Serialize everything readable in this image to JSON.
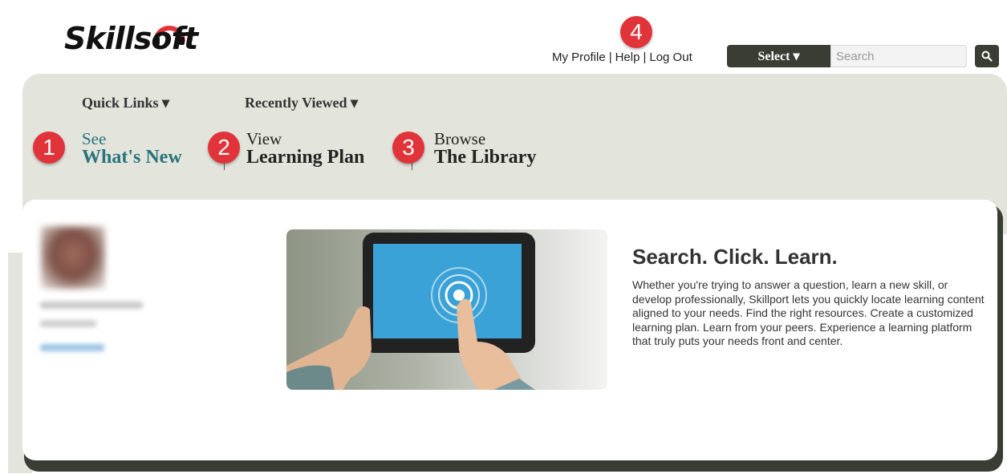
{
  "brand": {
    "logo_text": "Skillsoft",
    "colors": {
      "accent": "#e0343a",
      "dark": "#3a3d34",
      "band": "#e3e5dc",
      "teal": "#27737c"
    }
  },
  "topnav": {
    "my_profile": "My Profile",
    "help": "Help",
    "log_out": "Log Out",
    "select_label": "Select ▾",
    "search_placeholder": "Search",
    "search_icon": "search-icon"
  },
  "menu": {
    "quick_links": "Quick Links ▾",
    "recently_viewed": "Recently Viewed ▾"
  },
  "nav_links": [
    {
      "small": "See",
      "big": "What's New"
    },
    {
      "small": "View",
      "big": "Learning Plan"
    },
    {
      "small": "Browse",
      "big": "The Library"
    }
  ],
  "badges": [
    "1",
    "2",
    "3",
    "4"
  ],
  "main": {
    "headline": "Search. Click. Learn.",
    "blurb": "Whether you're trying to answer a question, learn a new skill, or develop professionally, Skillport lets you quickly locate learning content aligned to your needs. Find the right resources. Create a customized learning plan. Learn from your peers. Experience a learning platform that truly puts your needs front and center."
  }
}
